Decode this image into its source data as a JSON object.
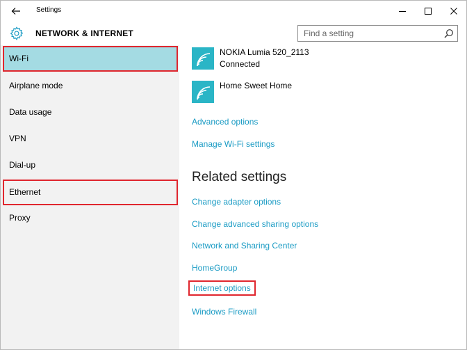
{
  "window": {
    "title": "Settings"
  },
  "header": {
    "section_title": "NETWORK & INTERNET",
    "search_placeholder": "Find a setting"
  },
  "sidebar": {
    "items": [
      {
        "label": "Wi-Fi",
        "selected": true
      },
      {
        "label": "Airplane mode"
      },
      {
        "label": "Data usage"
      },
      {
        "label": "VPN"
      },
      {
        "label": "Dial-up"
      },
      {
        "label": "Ethernet"
      },
      {
        "label": "Proxy"
      }
    ]
  },
  "wifi": {
    "networks": [
      {
        "name": "NOKIA Lumia 520_2113",
        "status": "Connected"
      },
      {
        "name": "Home Sweet Home",
        "status": ""
      }
    ],
    "links": [
      "Advanced options",
      "Manage Wi-Fi settings"
    ]
  },
  "related": {
    "heading": "Related settings",
    "links": [
      "Change adapter options",
      "Change advanced sharing options",
      "Network and Sharing Center",
      "HomeGroup",
      "Internet options",
      "Windows Firewall"
    ]
  },
  "colors": {
    "accent": "#1a9bc4",
    "selected_bg": "#a4dbe3",
    "wifi_tile": "#2ab5c6",
    "highlight_border": "#e0262e",
    "sidebar_bg": "#f2f2f2"
  },
  "icons": {
    "back": "back-arrow-icon",
    "minimize": "minimize-icon",
    "maximize": "maximize-icon",
    "close": "close-icon",
    "settings": "gear-icon",
    "search": "search-icon",
    "wifi": "wifi-icon"
  }
}
